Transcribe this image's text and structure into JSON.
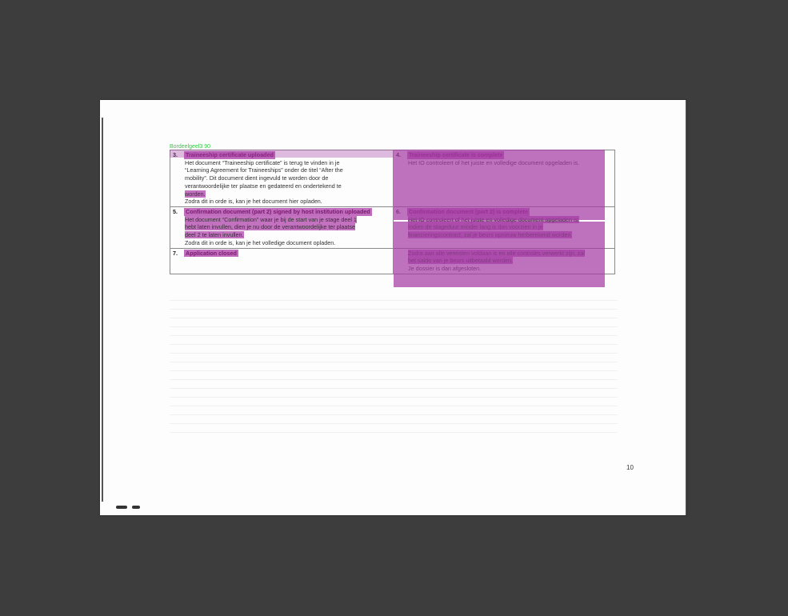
{
  "annotation_label": "Bordeelgeel3 90",
  "steps": [
    {
      "number": "3.",
      "title": "Traineeship certificate uploaded",
      "lines": [
        "Het document “Traineeship certificate” is terug te vinden in je",
        "“Learning Agreement for Traineeships” onder de titel “After the",
        "mobility”. Dit document dient ingevuld te worden door de",
        "verantwoordelijke ter plaatse en gedateerd en ondertekend te",
        "worden.",
        "Zodra dit in orde is, kan je het document hier opladen."
      ]
    },
    {
      "number": "4.",
      "title": "Traineeship certificate is complete",
      "lines": [
        "Het IO controleert of het juiste en volledige document opgeladen is."
      ]
    },
    {
      "number": "5.",
      "title": "Confirmation document (part 2) signed by host institution uploaded",
      "lines": [
        "Het document “Confirmation” waar je bij de start van je stage deel 1",
        "hebt laten invullen, dien je nu door de verantwoordelijke ter plaatse",
        "deel 2 te laten invullen.",
        "Zodra dit in orde is, kan je het volledige document opladen."
      ]
    },
    {
      "number": "6.",
      "title": "Confirmation document (part 2) is complete",
      "lines": [
        "Het IO controleert of het juiste en volledige document opgeladen is.",
        "Indien de stageduur minder lang is dan voorzien in je",
        "financieringscontract, zal je beurs opnieuw herberekend worden."
      ]
    },
    {
      "number": "7.",
      "title": "Application closed",
      "lines": []
    },
    {
      "number": "",
      "title": "",
      "lines": [
        "Zodra aan alle vereisten voldaan is en alle controles verwerkt zijn, zal",
        "het saldo van je beurs uitbetaald worden.",
        "Je dossier is dan afgesloten."
      ]
    }
  ],
  "page_number": "10"
}
